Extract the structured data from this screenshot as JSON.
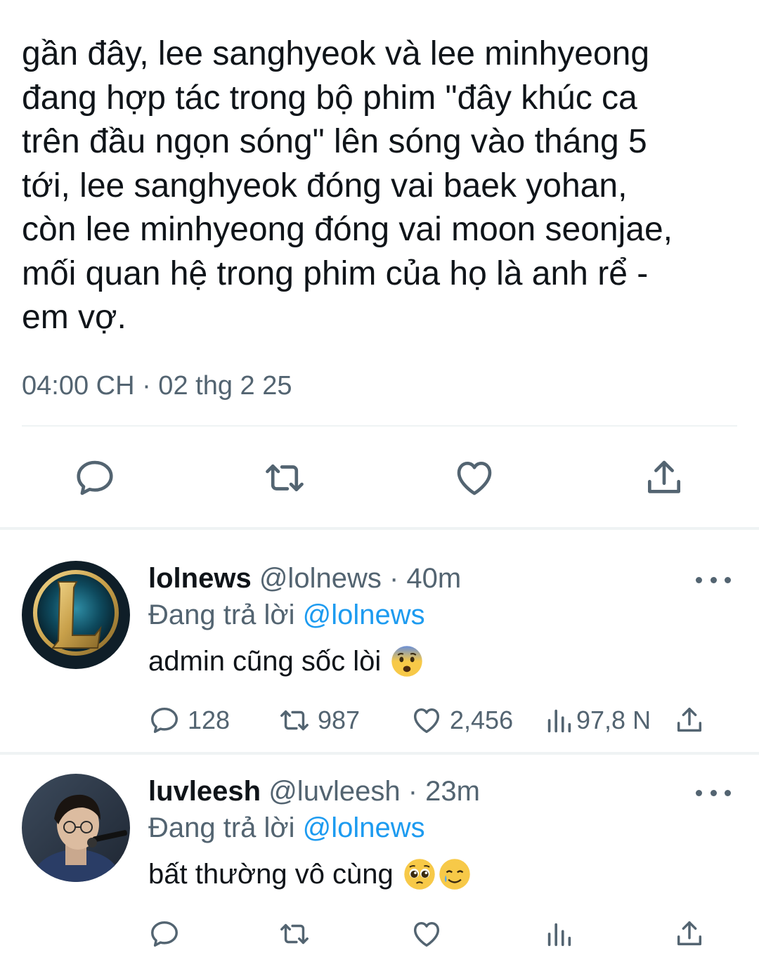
{
  "main_tweet": {
    "text": "gần đây, lee sanghyeok và lee minhyeong\nđang hợp tác trong bộ phim \"đây khúc ca\ntrên đầu ngọn sóng\" lên sóng vào tháng 5\ntới, lee sanghyeok đóng vai baek yohan,\ncòn lee minhyeong đóng vai moon seonjae,\nmối quan hệ trong phim của họ là anh rể -\nem vợ.",
    "timestamp": "04:00 CH · 02 thg 2 25",
    "actions": [
      "reply-icon",
      "retweet-icon",
      "like-icon",
      "share-icon"
    ]
  },
  "replies": [
    {
      "name": "lolnews",
      "handle": "@lolnews",
      "dot": "·",
      "time": "40m",
      "replying_prefix": "Đang trả lời",
      "replying_to": "@lolnews",
      "text": "admin cũng sốc lòi",
      "emojis": [
        "fearful-face-emoji"
      ],
      "counts": {
        "replies": "128",
        "retweets": "987",
        "likes": "2,456",
        "views": "97,8 N"
      }
    },
    {
      "name": "luvleesh",
      "handle": "@luvleesh",
      "dot": "·",
      "time": "23m",
      "replying_prefix": "Đang trả lời",
      "replying_to": "@lolnews",
      "text": "bất thường vô cùng",
      "emojis": [
        "pleading-face-emoji",
        "smiling-face-with-tear-emoji"
      ],
      "counts": {
        "replies": "",
        "retweets": "",
        "likes": "",
        "views": ""
      }
    }
  ],
  "colors": {
    "text_primary": "#0f1419",
    "text_secondary": "#536471",
    "link": "#1d9bf0",
    "divider": "#eff3f4"
  }
}
